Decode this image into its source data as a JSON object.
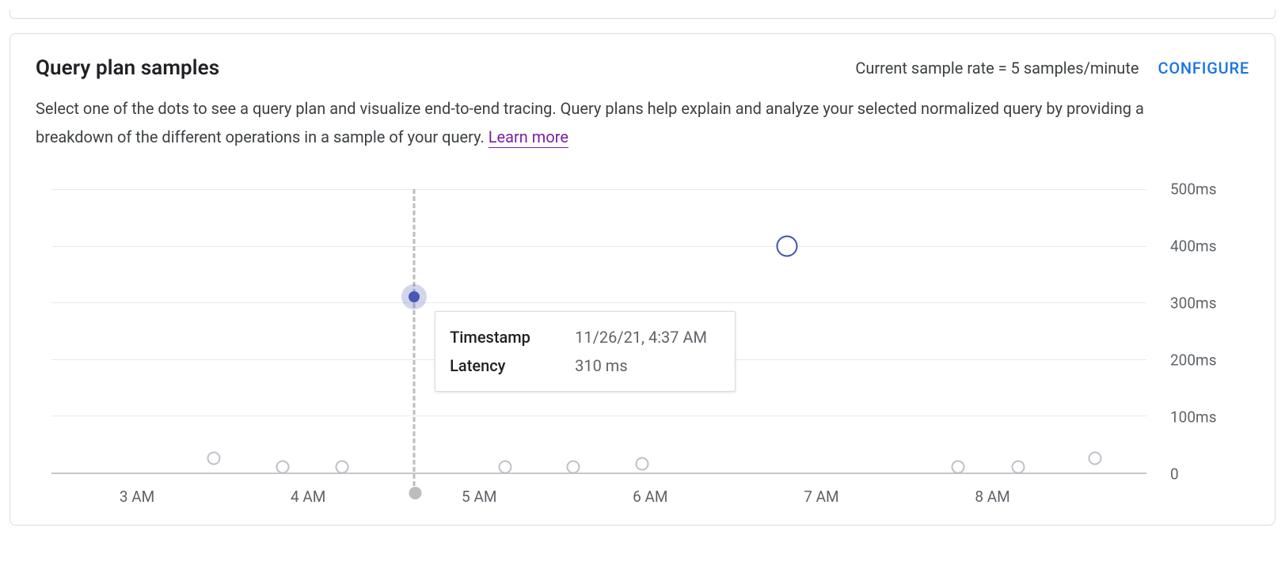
{
  "header": {
    "title": "Query plan samples",
    "sample_rate_text": "Current sample rate = 5 samples/minute",
    "configure_label": "CONFIGURE"
  },
  "description": {
    "text": "Select one of the dots to see a query plan and visualize end-to-end tracing. Query plans help explain and analyze your selected normalized query by providing a breakdown of the different operations in a sample of your query. ",
    "learn_more_label": "Learn more"
  },
  "tooltip": {
    "timestamp_label": "Timestamp",
    "timestamp_value": "11/26/21, 4:37 AM",
    "latency_label": "Latency",
    "latency_value": "310 ms"
  },
  "chart_data": {
    "type": "scatter",
    "xlabel": "",
    "ylabel": "",
    "y_unit": "ms",
    "ylim": [
      0,
      500
    ],
    "y_ticks": [
      0,
      100,
      200,
      300,
      400,
      500
    ],
    "y_tick_labels": [
      "0",
      "100ms",
      "200ms",
      "300ms",
      "400ms",
      "500ms"
    ],
    "x_domain_hours": [
      2.5,
      8.9
    ],
    "x_ticks_hours": [
      3,
      4,
      5,
      6,
      7,
      8
    ],
    "x_tick_labels": [
      "3 AM",
      "4 AM",
      "5 AM",
      "6 AM",
      "7 AM",
      "8 AM"
    ],
    "cursor_x_hour": 4.62,
    "points": [
      {
        "x_hour": 3.45,
        "latency_ms": 25,
        "state": "grey"
      },
      {
        "x_hour": 3.85,
        "latency_ms": 10,
        "state": "grey"
      },
      {
        "x_hour": 4.2,
        "latency_ms": 10,
        "state": "grey"
      },
      {
        "x_hour": 4.62,
        "latency_ms": 310,
        "state": "selected"
      },
      {
        "x_hour": 5.15,
        "latency_ms": 10,
        "state": "grey"
      },
      {
        "x_hour": 5.55,
        "latency_ms": 10,
        "state": "grey"
      },
      {
        "x_hour": 5.95,
        "latency_ms": 15,
        "state": "grey"
      },
      {
        "x_hour": 6.8,
        "latency_ms": 400,
        "state": "ring"
      },
      {
        "x_hour": 7.8,
        "latency_ms": 10,
        "state": "grey"
      },
      {
        "x_hour": 8.15,
        "latency_ms": 10,
        "state": "grey"
      },
      {
        "x_hour": 8.6,
        "latency_ms": 25,
        "state": "grey"
      }
    ]
  }
}
